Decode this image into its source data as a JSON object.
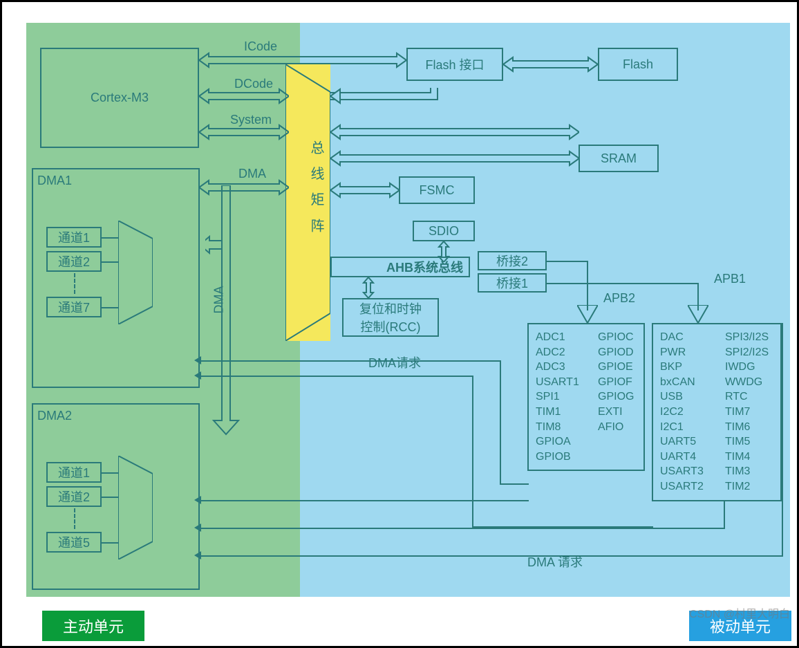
{
  "zones": {
    "active": "主动单元",
    "passive": "被动单元"
  },
  "cortex": "Cortex-M3",
  "buses": {
    "icode": "ICode",
    "dcode": "DCode",
    "system": "System",
    "dma": "DMA",
    "dma_v": "DMA"
  },
  "matrix": "总 线 矩 阵",
  "dma1": {
    "title": "DMA1",
    "ch1": "通道1",
    "ch2": "通道2",
    "ch7": "通道7"
  },
  "dma2": {
    "title": "DMA2",
    "ch1": "通道1",
    "ch2": "通道2",
    "ch5": "通道5"
  },
  "flash_if": "Flash 接口",
  "flash": "Flash",
  "sram": "SRAM",
  "fsmc": "FSMC",
  "sdio": "SDIO",
  "ahb": "AHB系统总线",
  "bridge1": "桥接1",
  "bridge2": "桥接2",
  "apb1": "APB1",
  "apb2": "APB2",
  "rcc": {
    "line1": "复位和时钟",
    "line2": "控制(RCC)"
  },
  "dma_req1": "DMA请求",
  "dma_req2": "DMA 请求",
  "apb2_left": [
    "ADC1",
    "ADC2",
    "ADC3",
    "USART1",
    "SPI1",
    "TIM1",
    "TIM8",
    "GPIOA",
    "GPIOB"
  ],
  "apb2_right": [
    "GPIOC",
    "GPIOD",
    "GPIOE",
    "GPIOF",
    "GPIOG",
    "EXTI",
    "AFIO"
  ],
  "apb1_left": [
    "DAC",
    "PWR",
    "BKP",
    "bxCAN",
    "USB",
    "I2C2",
    "I2C1",
    "UART5",
    "UART4",
    "USART3",
    "USART2"
  ],
  "apb1_right": [
    "SPI3/I2S",
    "SPI2/I2S",
    "IWDG",
    "WWDG",
    "RTC",
    "TIM7",
    "TIM6",
    "TIM5",
    "TIM4",
    "TIM3",
    "TIM2"
  ],
  "watermark": "CSDN @村里大明白"
}
